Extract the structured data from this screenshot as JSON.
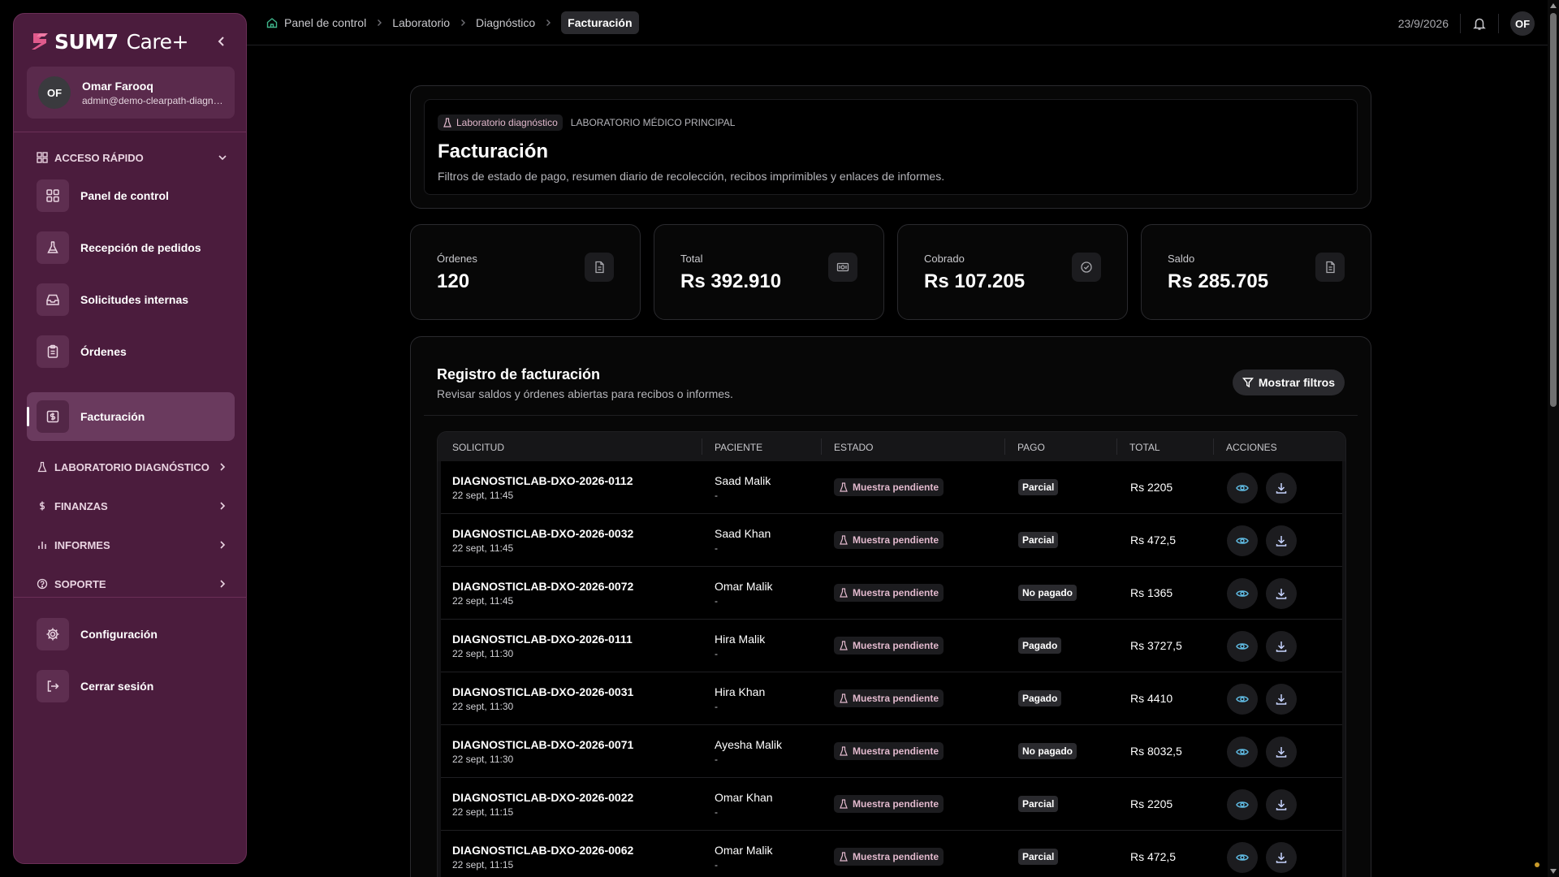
{
  "brand": {
    "name": "SUM7",
    "product": "Care+"
  },
  "user": {
    "initials": "OF",
    "name": "Omar Farooq",
    "email": "admin@demo-clearpath-diagnostics"
  },
  "sidebar": {
    "quick_access": "Acceso rápido",
    "items": [
      {
        "label": "Panel de control",
        "icon": "dashboard-icon"
      },
      {
        "label": "Recepción de pedidos",
        "icon": "flask-icon"
      },
      {
        "label": "Solicitudes internas",
        "icon": "inbox-icon"
      },
      {
        "label": "Órdenes",
        "icon": "clipboard-icon"
      },
      {
        "label": "Facturación",
        "icon": "billing-icon"
      }
    ],
    "sections": [
      "Laboratorio diagnóstico",
      "Finanzas",
      "Informes",
      "Soporte"
    ],
    "bottom": [
      {
        "label": "Configuración",
        "icon": "gear-icon"
      },
      {
        "label": "Cerrar sesión",
        "icon": "logout-icon"
      }
    ]
  },
  "breadcrumbs": [
    "Panel de control",
    "Laboratorio",
    "Diagnóstico",
    "Facturación"
  ],
  "topbar": {
    "date": "23/9/2026",
    "initials": "OF"
  },
  "header": {
    "tag": "Laboratorio diagnóstico",
    "lab": "Laboratorio médico principal",
    "title": "Facturación",
    "subtitle": "Filtros de estado de pago, resumen diario de recolección, recibos imprimibles y enlaces de informes."
  },
  "stats": [
    {
      "label": "Órdenes",
      "value": "120",
      "icon": "document-icon"
    },
    {
      "label": "Total",
      "value": "Rs 392.910",
      "icon": "cash-icon"
    },
    {
      "label": "Cobrado",
      "value": "Rs 107.205",
      "icon": "check-circle-icon"
    },
    {
      "label": "Saldo",
      "value": "Rs 285.705",
      "icon": "document-icon"
    }
  ],
  "register": {
    "title": "Registro de facturación",
    "subtitle": "Revisar saldos y órdenes abiertas para recibos o informes.",
    "filter_button": "Mostrar filtros",
    "columns": [
      "Solicitud",
      "Paciente",
      "Estado",
      "Pago",
      "Total",
      "Acciones"
    ],
    "rows": [
      {
        "id": "DIAGNOSTICLAB-DXO-2026-0112",
        "time": "22 sept, 11:45",
        "patient": "Saad Malik",
        "patient_sub": "-",
        "status": "Muestra pendiente",
        "payment": "Parcial",
        "total": "Rs 2205"
      },
      {
        "id": "DIAGNOSTICLAB-DXO-2026-0032",
        "time": "22 sept, 11:45",
        "patient": "Saad Khan",
        "patient_sub": "-",
        "status": "Muestra pendiente",
        "payment": "Parcial",
        "total": "Rs 472,5"
      },
      {
        "id": "DIAGNOSTICLAB-DXO-2026-0072",
        "time": "22 sept, 11:45",
        "patient": "Omar Malik",
        "patient_sub": "-",
        "status": "Muestra pendiente",
        "payment": "No pagado",
        "total": "Rs 1365"
      },
      {
        "id": "DIAGNOSTICLAB-DXO-2026-0111",
        "time": "22 sept, 11:30",
        "patient": "Hira Malik",
        "patient_sub": "-",
        "status": "Muestra pendiente",
        "payment": "Pagado",
        "total": "Rs 3727,5"
      },
      {
        "id": "DIAGNOSTICLAB-DXO-2026-0031",
        "time": "22 sept, 11:30",
        "patient": "Hira Khan",
        "patient_sub": "-",
        "status": "Muestra pendiente",
        "payment": "Pagado",
        "total": "Rs 4410"
      },
      {
        "id": "DIAGNOSTICLAB-DXO-2026-0071",
        "time": "22 sept, 11:30",
        "patient": "Ayesha Malik",
        "patient_sub": "-",
        "status": "Muestra pendiente",
        "payment": "No pagado",
        "total": "Rs 8032,5"
      },
      {
        "id": "DIAGNOSTICLAB-DXO-2026-0022",
        "time": "22 sept, 11:15",
        "patient": "Omar Khan",
        "patient_sub": "-",
        "status": "Muestra pendiente",
        "payment": "Parcial",
        "total": "Rs 2205"
      },
      {
        "id": "DIAGNOSTICLAB-DXO-2026-0062",
        "time": "22 sept, 11:15",
        "patient": "Omar Malik",
        "patient_sub": "-",
        "status": "Muestra pendiente",
        "payment": "Parcial",
        "total": "Rs 472,5"
      }
    ]
  },
  "colors": {
    "sidebar": "#4b1c3d",
    "accent_status": "#e2b9cd",
    "view_icon": "#5fb9e0",
    "home_icon": "#3fb58a"
  }
}
